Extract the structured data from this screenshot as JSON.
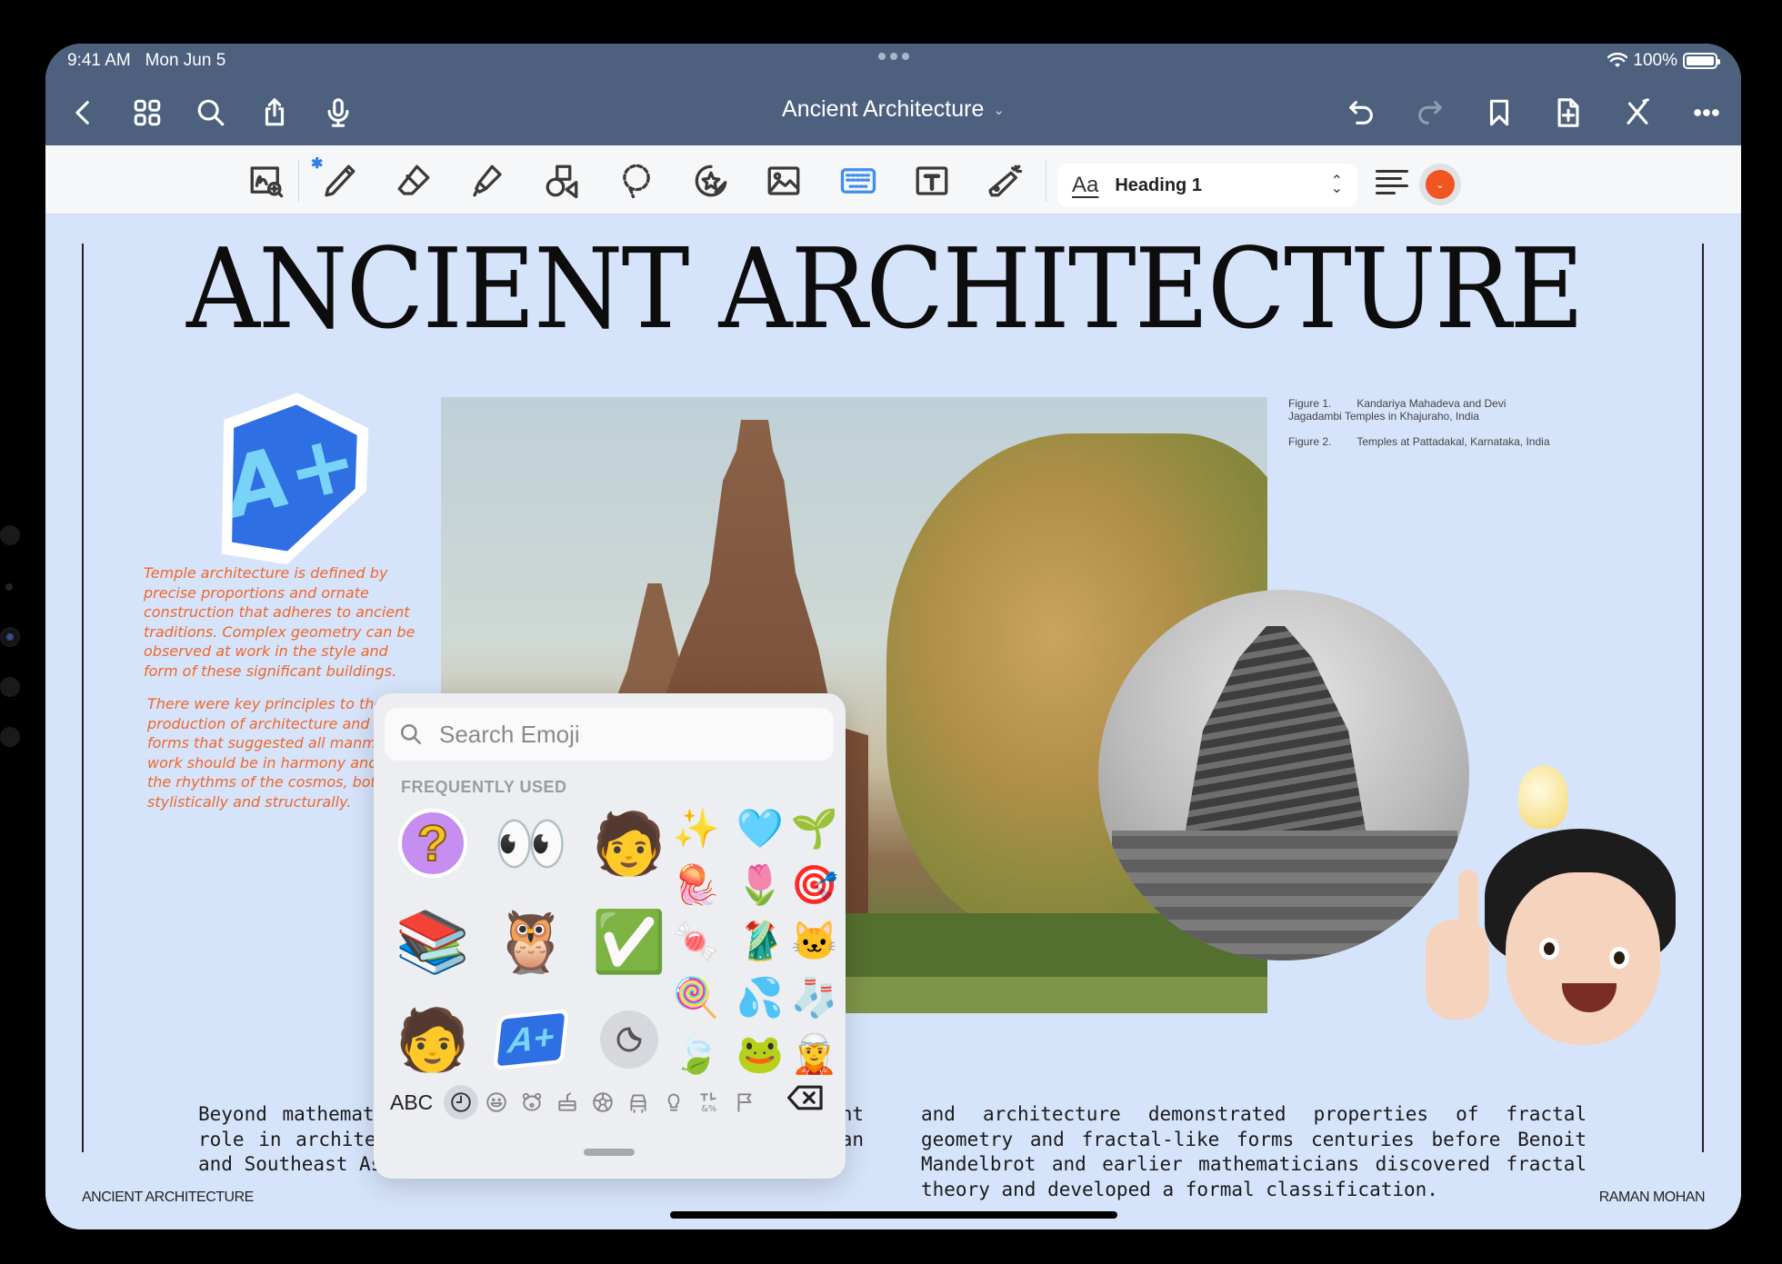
{
  "status_bar": {
    "time": "9:41 AM",
    "date": "Mon Jun 5",
    "battery": "100%",
    "battery_level": 1.0
  },
  "nav": {
    "document_title": "Ancient Architecture",
    "left_icons": [
      "back-icon",
      "grid-icon",
      "search-icon",
      "share-icon",
      "microphone-icon"
    ],
    "right_icons": [
      "undo-icon",
      "redo-icon",
      "bookmark-icon",
      "add-page-icon",
      "close-toolbar-icon",
      "more-icon"
    ]
  },
  "toolbar": {
    "tools": [
      "zoom-window",
      "pen",
      "eraser",
      "highlighter",
      "shapes",
      "lasso",
      "stickers",
      "image",
      "keyboard",
      "text-box",
      "laser-pointer"
    ],
    "active_tool": "keyboard",
    "text_style": "Heading 1",
    "text_style_icon": "Aa",
    "accent_color": "#f05522"
  },
  "page": {
    "title": "ANCIENT ARCHITECTURE",
    "figure_captions": [
      {
        "label": "Figure 1.",
        "text": "Kandariya Mahadeva and Devi Jagadambi Temples in Khajuraho, India"
      },
      {
        "label": "Figure 2.",
        "text": "Temples at Pattadakal, Karnataka, India"
      }
    ],
    "handwritten_notes": [
      "Temple architecture is defined by precise proportions and ornate construction that adheres to ancient traditions. Complex geometry can be observed at work in the style and form of these significant buildings.",
      "There were key principles to the production of architecture and artistic forms that suggested all manmade work should be in harmony and with the rhythms of the cosmos, both stylistically and structurally."
    ],
    "body_columns": [
      "Beyond mathematics, fractal structures play an important role in architecture, and can be found throughout Indian and Southeast Asian temples and monuments. In India, art",
      "and architecture demonstrated properties of fractal geometry and fractal-like forms centuries before Benoit Mandelbrot and earlier mathematicians discovered fractal theory and developed a formal classification."
    ],
    "footer_left": "ANCIENT ARCHITECTURE",
    "footer_right": "RAMAN MOHAN",
    "handwriting_color": "#f0662a",
    "background_color": "#d6e4fb"
  },
  "emoji_picker": {
    "search_placeholder": "Search Emoji",
    "search_value": "",
    "section_label": "FREQUENTLY USED",
    "large_items": [
      {
        "name": "question-pencil-sticker",
        "glyph": "?"
      },
      {
        "name": "eyes",
        "glyph": "👀"
      },
      {
        "name": "memoji-lightbulb",
        "glyph": "🧑"
      },
      {
        "name": "books",
        "glyph": "📚"
      },
      {
        "name": "mind-blown-owl",
        "glyph": "🦉"
      },
      {
        "name": "check-mark-button",
        "glyph": "✅"
      },
      {
        "name": "memoji-heart-hands",
        "glyph": "🧑"
      },
      {
        "name": "a-plus-sticker",
        "glyph": "A+"
      },
      {
        "name": "stickers-button",
        "glyph": ""
      }
    ],
    "small_items": [
      {
        "name": "sparkles",
        "glyph": "✨"
      },
      {
        "name": "light-blue-heart",
        "glyph": "🩵"
      },
      {
        "name": "seedling",
        "glyph": "🌱"
      },
      {
        "name": "jellyfish",
        "glyph": "🪼"
      },
      {
        "name": "tulip",
        "glyph": "🌷"
      },
      {
        "name": "direct-hit",
        "glyph": "🎯"
      },
      {
        "name": "candy",
        "glyph": "🍬"
      },
      {
        "name": "sari",
        "glyph": "🥻"
      },
      {
        "name": "cat-face",
        "glyph": "🐱"
      },
      {
        "name": "lollipop",
        "glyph": "🍭"
      },
      {
        "name": "sweat-droplets",
        "glyph": "💦"
      },
      {
        "name": "socks",
        "glyph": "🧦"
      },
      {
        "name": "leaves",
        "glyph": "🍃"
      },
      {
        "name": "frog",
        "glyph": "🐸"
      },
      {
        "name": "elf",
        "glyph": "🧝"
      }
    ],
    "abc_label": "ABC",
    "categories": [
      "recent",
      "smileys",
      "animals",
      "food",
      "activity",
      "travel",
      "objects",
      "symbols",
      "flags"
    ],
    "active_category": "recent"
  }
}
